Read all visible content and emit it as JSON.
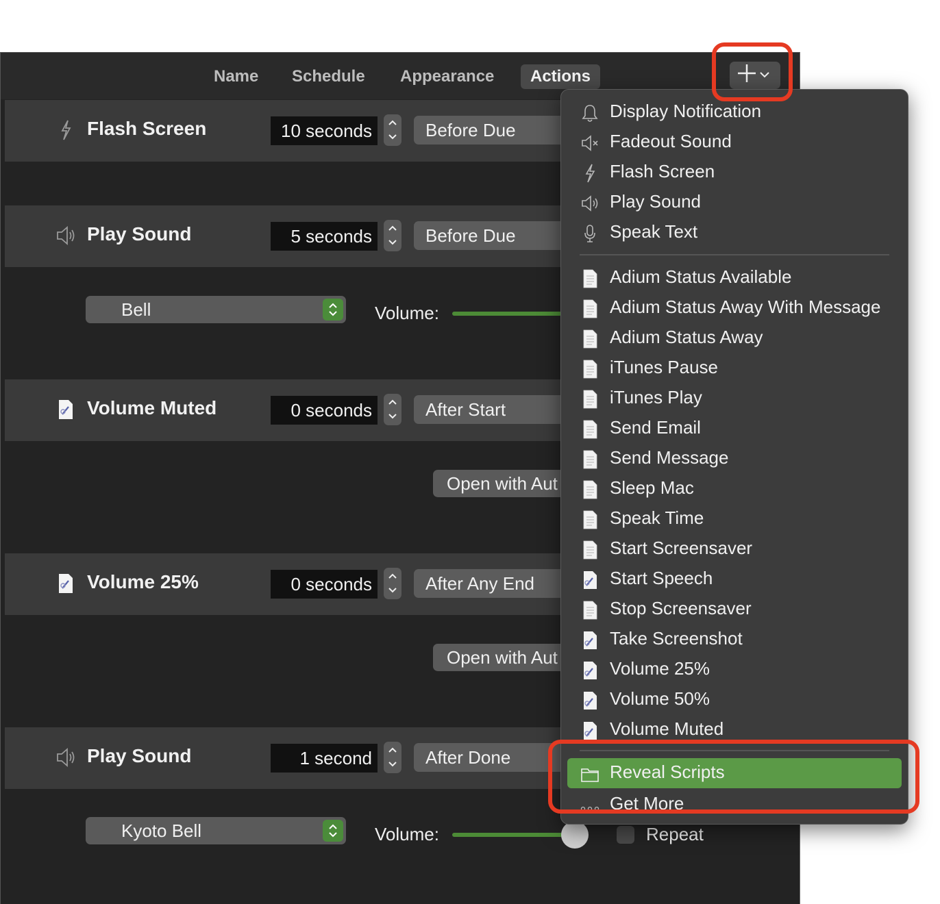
{
  "toolbar": {
    "tabs": [
      "Name",
      "Schedule",
      "Appearance",
      "Actions"
    ],
    "active_tab": "Actions",
    "add_button_icon": "plus-icon"
  },
  "rows": [
    {
      "icon": "lightning-icon",
      "title": "Flash Screen",
      "duration": "10 seconds",
      "timing": "Before Due"
    },
    {
      "icon": "speaker-icon",
      "title": "Play Sound",
      "duration": "5 seconds",
      "timing": "Before Due",
      "sound": "Bell",
      "volume_label": "Volume:"
    },
    {
      "icon": "script-icon",
      "title": "Volume Muted",
      "duration": "0 seconds",
      "timing": "After Start",
      "open_button": "Open with Aut"
    },
    {
      "icon": "script-icon",
      "title": "Volume 25%",
      "duration": "0 seconds",
      "timing": "After Any End",
      "open_button": "Open with Aut"
    },
    {
      "icon": "speaker-icon",
      "title": "Play Sound",
      "duration": "1 second",
      "timing": "After Done",
      "sound": "Kyoto Bell",
      "volume_label": "Volume:",
      "repeat_label": "Repeat"
    }
  ],
  "menu": {
    "builtin": [
      {
        "label": "Display Notification",
        "icon": "bell-icon"
      },
      {
        "label": "Fadeout Sound",
        "icon": "speaker-mute-icon"
      },
      {
        "label": "Flash Screen",
        "icon": "lightning-icon"
      },
      {
        "label": "Play Sound",
        "icon": "speaker-icon"
      },
      {
        "label": "Speak Text",
        "icon": "microphone-icon"
      }
    ],
    "scripts": [
      {
        "label": "Adium Status Available",
        "icon": "document-icon"
      },
      {
        "label": "Adium Status Away With Message",
        "icon": "document-icon"
      },
      {
        "label": "Adium Status Away",
        "icon": "document-icon"
      },
      {
        "label": "iTunes Pause",
        "icon": "document-icon"
      },
      {
        "label": "iTunes Play",
        "icon": "document-icon"
      },
      {
        "label": "Send Email",
        "icon": "document-icon"
      },
      {
        "label": "Send Message",
        "icon": "document-icon"
      },
      {
        "label": "Sleep Mac",
        "icon": "document-icon"
      },
      {
        "label": "Speak Time",
        "icon": "document-icon"
      },
      {
        "label": "Start Screensaver",
        "icon": "document-icon"
      },
      {
        "label": "Start Speech",
        "icon": "script-icon"
      },
      {
        "label": "Stop Screensaver",
        "icon": "document-icon"
      },
      {
        "label": "Take Screenshot",
        "icon": "script-icon"
      },
      {
        "label": "Volume 25%",
        "icon": "script-icon"
      },
      {
        "label": "Volume 50%",
        "icon": "script-icon"
      },
      {
        "label": "Volume Muted",
        "icon": "script-icon"
      }
    ],
    "footer": [
      {
        "label": "Reveal Scripts",
        "icon": "folder-icon",
        "highlighted": true
      },
      {
        "label": "Get More",
        "icon": "ellipsis-icon"
      }
    ]
  },
  "colors": {
    "accent_green": "#5b9a47",
    "annotation_red": "#e53a22",
    "volume_track": "#4c8b36"
  }
}
